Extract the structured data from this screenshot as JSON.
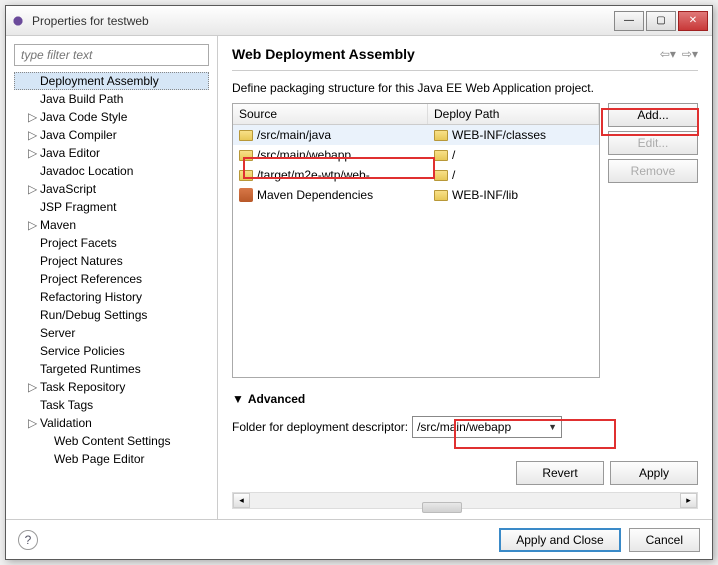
{
  "window": {
    "title": "Properties for testweb"
  },
  "filter": {
    "placeholder": "type filter text"
  },
  "tree": [
    {
      "label": "Deployment Assembly",
      "arrow": "",
      "selected": true,
      "child": false
    },
    {
      "label": "Java Build Path",
      "arrow": "",
      "child": false
    },
    {
      "label": "Java Code Style",
      "arrow": "▷",
      "child": false
    },
    {
      "label": "Java Compiler",
      "arrow": "▷",
      "child": false
    },
    {
      "label": "Java Editor",
      "arrow": "▷",
      "child": false
    },
    {
      "label": "Javadoc Location",
      "arrow": "",
      "child": false
    },
    {
      "label": "JavaScript",
      "arrow": "▷",
      "child": false
    },
    {
      "label": "JSP Fragment",
      "arrow": "",
      "child": false
    },
    {
      "label": "Maven",
      "arrow": "▷",
      "child": false
    },
    {
      "label": "Project Facets",
      "arrow": "",
      "child": false
    },
    {
      "label": "Project Natures",
      "arrow": "",
      "child": false
    },
    {
      "label": "Project References",
      "arrow": "",
      "child": false
    },
    {
      "label": "Refactoring History",
      "arrow": "",
      "child": false
    },
    {
      "label": "Run/Debug Settings",
      "arrow": "",
      "child": false
    },
    {
      "label": "Server",
      "arrow": "",
      "child": false
    },
    {
      "label": "Service Policies",
      "arrow": "",
      "child": false
    },
    {
      "label": "Targeted Runtimes",
      "arrow": "",
      "child": false
    },
    {
      "label": "Task Repository",
      "arrow": "▷",
      "child": false
    },
    {
      "label": "Task Tags",
      "arrow": "",
      "child": false
    },
    {
      "label": "Validation",
      "arrow": "▷",
      "child": false
    },
    {
      "label": "Web Content Settings",
      "arrow": "",
      "child": true
    },
    {
      "label": "Web Page Editor",
      "arrow": "",
      "child": true
    }
  ],
  "right": {
    "title": "Web Deployment Assembly",
    "desc": "Define packaging structure for this Java EE Web Application project.",
    "columns": {
      "source": "Source",
      "deploy": "Deploy Path"
    },
    "rows": [
      {
        "src": "/src/main/java",
        "dep": "WEB-INF/classes",
        "icon": "folder",
        "sel": true
      },
      {
        "src": "/src/main/webapp",
        "dep": "/",
        "icon": "folder",
        "sel": false
      },
      {
        "src": "/target/m2e-wtp/web-",
        "dep": "/",
        "icon": "folder",
        "sel": false
      },
      {
        "src": "Maven Dependencies",
        "dep": "WEB-INF/lib",
        "icon": "jar",
        "sel": false
      }
    ],
    "buttons": {
      "add": "Add...",
      "edit": "Edit...",
      "remove": "Remove"
    },
    "advanced": {
      "heading": "Advanced",
      "label": "Folder for deployment descriptor:",
      "value": "/src/main/webapp"
    },
    "revert": "Revert",
    "apply": "Apply"
  },
  "bottom": {
    "applyClose": "Apply and Close",
    "cancel": "Cancel"
  }
}
